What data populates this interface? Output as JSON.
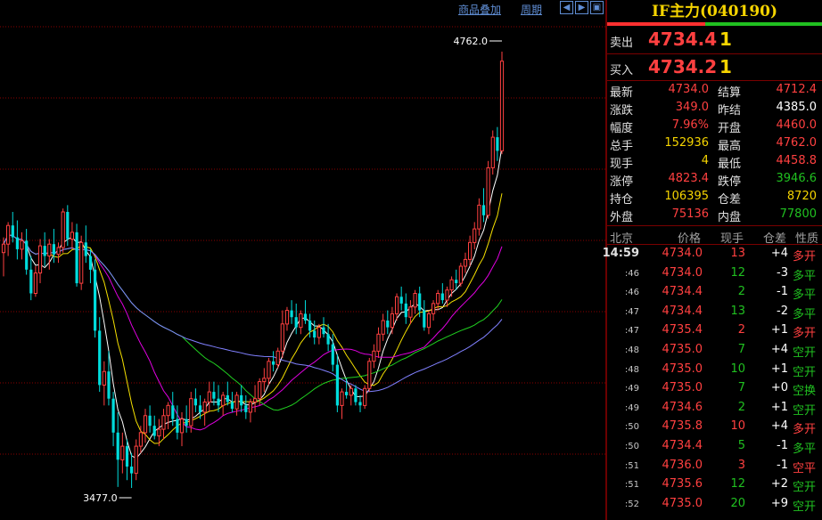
{
  "colors": {
    "up": "#ff4040",
    "down": "#00dcdc",
    "yellow": "#f5d400",
    "green": "#20c020",
    "grid": "#8a0000",
    "ma_white": "#ffffff",
    "ma_yellow": "#f5e000",
    "ma_magenta": "#e000e0",
    "ma_green": "#20d020",
    "ma_blue": "#8080ff"
  },
  "toolbar": {
    "overlay_label": "商品叠加",
    "period_label": "周期",
    "nav_icons": [
      "arrow-left-icon",
      "arrow-right-icon",
      "restore-icon"
    ]
  },
  "chart": {
    "high_label": "4762.0",
    "low_label": "3477.0",
    "candles": [
      {
        "o": 4170,
        "h": 4215,
        "l": 4100,
        "c": 4195
      },
      {
        "o": 4195,
        "h": 4260,
        "l": 4160,
        "c": 4250
      },
      {
        "o": 4250,
        "h": 4290,
        "l": 4200,
        "c": 4215
      },
      {
        "o": 4215,
        "h": 4265,
        "l": 4150,
        "c": 4180
      },
      {
        "o": 4180,
        "h": 4230,
        "l": 4150,
        "c": 4205
      },
      {
        "o": 4205,
        "h": 4240,
        "l": 4105,
        "c": 4120
      },
      {
        "o": 4120,
        "h": 4160,
        "l": 4030,
        "c": 4050
      },
      {
        "o": 4050,
        "h": 4130,
        "l": 4040,
        "c": 4110
      },
      {
        "o": 4110,
        "h": 4210,
        "l": 4080,
        "c": 4190
      },
      {
        "o": 4190,
        "h": 4230,
        "l": 4130,
        "c": 4160
      },
      {
        "o": 4160,
        "h": 4210,
        "l": 4120,
        "c": 4195
      },
      {
        "o": 4195,
        "h": 4240,
        "l": 4140,
        "c": 4165
      },
      {
        "o": 4165,
        "h": 4200,
        "l": 4140,
        "c": 4185
      },
      {
        "o": 4185,
        "h": 4300,
        "l": 4170,
        "c": 4290
      },
      {
        "o": 4290,
        "h": 4310,
        "l": 4190,
        "c": 4210
      },
      {
        "o": 4210,
        "h": 4260,
        "l": 4180,
        "c": 4230
      },
      {
        "o": 4230,
        "h": 4255,
        "l": 4070,
        "c": 4080
      },
      {
        "o": 4080,
        "h": 4220,
        "l": 4060,
        "c": 4200
      },
      {
        "o": 4200,
        "h": 4250,
        "l": 4140,
        "c": 4160
      },
      {
        "o": 4160,
        "h": 4180,
        "l": 4080,
        "c": 4120
      },
      {
        "o": 4120,
        "h": 4150,
        "l": 3920,
        "c": 3940
      },
      {
        "o": 3940,
        "h": 3980,
        "l": 3760,
        "c": 3780
      },
      {
        "o": 3780,
        "h": 3850,
        "l": 3720,
        "c": 3820
      },
      {
        "o": 3820,
        "h": 3880,
        "l": 3720,
        "c": 3740
      },
      {
        "o": 3740,
        "h": 3760,
        "l": 3600,
        "c": 3640
      },
      {
        "o": 3640,
        "h": 3700,
        "l": 3480,
        "c": 3560
      },
      {
        "o": 3560,
        "h": 3640,
        "l": 3520,
        "c": 3600
      },
      {
        "o": 3600,
        "h": 3620,
        "l": 3500,
        "c": 3540
      },
      {
        "o": 3540,
        "h": 3580,
        "l": 3477,
        "c": 3520
      },
      {
        "o": 3520,
        "h": 3620,
        "l": 3500,
        "c": 3600
      },
      {
        "o": 3600,
        "h": 3660,
        "l": 3580,
        "c": 3640
      },
      {
        "o": 3640,
        "h": 3710,
        "l": 3610,
        "c": 3690
      },
      {
        "o": 3690,
        "h": 3720,
        "l": 3640,
        "c": 3660
      },
      {
        "o": 3660,
        "h": 3690,
        "l": 3620,
        "c": 3630
      },
      {
        "o": 3630,
        "h": 3680,
        "l": 3600,
        "c": 3650
      },
      {
        "o": 3650,
        "h": 3710,
        "l": 3620,
        "c": 3690
      },
      {
        "o": 3690,
        "h": 3730,
        "l": 3650,
        "c": 3720
      },
      {
        "o": 3720,
        "h": 3760,
        "l": 3660,
        "c": 3680
      },
      {
        "o": 3680,
        "h": 3720,
        "l": 3620,
        "c": 3640
      },
      {
        "o": 3640,
        "h": 3700,
        "l": 3600,
        "c": 3680
      },
      {
        "o": 3680,
        "h": 3720,
        "l": 3640,
        "c": 3660
      },
      {
        "o": 3660,
        "h": 3760,
        "l": 3640,
        "c": 3740
      },
      {
        "o": 3740,
        "h": 3770,
        "l": 3700,
        "c": 3720
      },
      {
        "o": 3720,
        "h": 3750,
        "l": 3680,
        "c": 3700
      },
      {
        "o": 3700,
        "h": 3740,
        "l": 3660,
        "c": 3730
      },
      {
        "o": 3730,
        "h": 3790,
        "l": 3700,
        "c": 3760
      },
      {
        "o": 3760,
        "h": 3790,
        "l": 3720,
        "c": 3740
      },
      {
        "o": 3740,
        "h": 3780,
        "l": 3700,
        "c": 3720
      },
      {
        "o": 3720,
        "h": 3760,
        "l": 3690,
        "c": 3750
      },
      {
        "o": 3750,
        "h": 3790,
        "l": 3720,
        "c": 3730
      },
      {
        "o": 3730,
        "h": 3760,
        "l": 3700,
        "c": 3710
      },
      {
        "o": 3710,
        "h": 3760,
        "l": 3690,
        "c": 3750
      },
      {
        "o": 3750,
        "h": 3780,
        "l": 3700,
        "c": 3720
      },
      {
        "o": 3720,
        "h": 3750,
        "l": 3680,
        "c": 3700
      },
      {
        "o": 3700,
        "h": 3740,
        "l": 3670,
        "c": 3730
      },
      {
        "o": 3730,
        "h": 3780,
        "l": 3700,
        "c": 3740
      },
      {
        "o": 3740,
        "h": 3800,
        "l": 3720,
        "c": 3790
      },
      {
        "o": 3790,
        "h": 3830,
        "l": 3760,
        "c": 3800
      },
      {
        "o": 3800,
        "h": 3860,
        "l": 3780,
        "c": 3850
      },
      {
        "o": 3850,
        "h": 3880,
        "l": 3820,
        "c": 3840
      },
      {
        "o": 3840,
        "h": 3890,
        "l": 3830,
        "c": 3880
      },
      {
        "o": 3880,
        "h": 4000,
        "l": 3860,
        "c": 3960
      },
      {
        "o": 3960,
        "h": 4010,
        "l": 3940,
        "c": 4000
      },
      {
        "o": 4000,
        "h": 4030,
        "l": 3960,
        "c": 3980
      },
      {
        "o": 3980,
        "h": 4020,
        "l": 3930,
        "c": 3950
      },
      {
        "o": 3950,
        "h": 4000,
        "l": 3930,
        "c": 3990
      },
      {
        "o": 3990,
        "h": 4030,
        "l": 3960,
        "c": 3970
      },
      {
        "o": 3970,
        "h": 3990,
        "l": 3920,
        "c": 3940
      },
      {
        "o": 3940,
        "h": 3970,
        "l": 3900,
        "c": 3920
      },
      {
        "o": 3920,
        "h": 3960,
        "l": 3900,
        "c": 3950
      },
      {
        "o": 3950,
        "h": 3980,
        "l": 3920,
        "c": 3930
      },
      {
        "o": 3930,
        "h": 3960,
        "l": 3880,
        "c": 3900
      },
      {
        "o": 3900,
        "h": 3930,
        "l": 3820,
        "c": 3840
      },
      {
        "o": 3840,
        "h": 3870,
        "l": 3700,
        "c": 3720
      },
      {
        "o": 3720,
        "h": 3770,
        "l": 3680,
        "c": 3760
      },
      {
        "o": 3760,
        "h": 3800,
        "l": 3740,
        "c": 3750
      },
      {
        "o": 3750,
        "h": 3780,
        "l": 3720,
        "c": 3770
      },
      {
        "o": 3770,
        "h": 3780,
        "l": 3720,
        "c": 3730
      },
      {
        "o": 3730,
        "h": 3750,
        "l": 3700,
        "c": 3720
      },
      {
        "o": 3720,
        "h": 3780,
        "l": 3710,
        "c": 3770
      },
      {
        "o": 3770,
        "h": 3860,
        "l": 3760,
        "c": 3850
      },
      {
        "o": 3850,
        "h": 3900,
        "l": 3830,
        "c": 3880
      },
      {
        "o": 3880,
        "h": 3950,
        "l": 3860,
        "c": 3930
      },
      {
        "o": 3930,
        "h": 3990,
        "l": 3910,
        "c": 3970
      },
      {
        "o": 3970,
        "h": 4000,
        "l": 3930,
        "c": 3950
      },
      {
        "o": 3950,
        "h": 4010,
        "l": 3930,
        "c": 3990
      },
      {
        "o": 3990,
        "h": 4050,
        "l": 3970,
        "c": 4040
      },
      {
        "o": 4040,
        "h": 4070,
        "l": 4000,
        "c": 4020
      },
      {
        "o": 4020,
        "h": 4050,
        "l": 3960,
        "c": 3980
      },
      {
        "o": 3980,
        "h": 4030,
        "l": 3960,
        "c": 4010
      },
      {
        "o": 4010,
        "h": 4060,
        "l": 3990,
        "c": 4050
      },
      {
        "o": 4050,
        "h": 4070,
        "l": 3980,
        "c": 4000
      },
      {
        "o": 4000,
        "h": 4030,
        "l": 3940,
        "c": 3950
      },
      {
        "o": 3950,
        "h": 4000,
        "l": 3930,
        "c": 3990
      },
      {
        "o": 3990,
        "h": 4030,
        "l": 3970,
        "c": 4020
      },
      {
        "o": 4020,
        "h": 4060,
        "l": 4000,
        "c": 4050
      },
      {
        "o": 4050,
        "h": 4080,
        "l": 4020,
        "c": 4030
      },
      {
        "o": 4030,
        "h": 4070,
        "l": 4010,
        "c": 4060
      },
      {
        "o": 4060,
        "h": 4100,
        "l": 4040,
        "c": 4090
      },
      {
        "o": 4090,
        "h": 4120,
        "l": 4060,
        "c": 4080
      },
      {
        "o": 4080,
        "h": 4140,
        "l": 4070,
        "c": 4130
      },
      {
        "o": 4130,
        "h": 4170,
        "l": 4110,
        "c": 4150
      },
      {
        "o": 4150,
        "h": 4220,
        "l": 4130,
        "c": 4200
      },
      {
        "o": 4200,
        "h": 4260,
        "l": 4180,
        "c": 4240
      },
      {
        "o": 4240,
        "h": 4330,
        "l": 4220,
        "c": 4310
      },
      {
        "o": 4310,
        "h": 4360,
        "l": 4260,
        "c": 4280
      },
      {
        "o": 4280,
        "h": 4440,
        "l": 4270,
        "c": 4420
      },
      {
        "o": 4420,
        "h": 4530,
        "l": 4400,
        "c": 4510
      },
      {
        "o": 4510,
        "h": 4540,
        "l": 4440,
        "c": 4470
      },
      {
        "o": 4470,
        "h": 4762,
        "l": 4460,
        "c": 4734
      }
    ]
  },
  "panel": {
    "title": "IF主力(040190)",
    "sell_label": "卖出",
    "sell_price": "4734.4",
    "sell_vol": "1",
    "buy_label": "买入",
    "buy_price": "4734.2",
    "buy_vol": "1",
    "stats": [
      {
        "l1": "最新",
        "v1": "4734.0",
        "c1": "#ff4040",
        "l2": "结算",
        "v2": "4712.4",
        "c2": "#ff4040"
      },
      {
        "l1": "涨跌",
        "v1": "349.0",
        "c1": "#ff4040",
        "l2": "昨结",
        "v2": "4385.0",
        "c2": "#ffffff"
      },
      {
        "l1": "幅度",
        "v1": "7.96%",
        "c1": "#ff4040",
        "l2": "开盘",
        "v2": "4460.0",
        "c2": "#ff4040"
      },
      {
        "l1": "总手",
        "v1": "152936",
        "c1": "#f5d400",
        "l2": "最高",
        "v2": "4762.0",
        "c2": "#ff4040"
      },
      {
        "l1": "现手",
        "v1": "4",
        "c1": "#f5d400",
        "l2": "最低",
        "v2": "4458.8",
        "c2": "#ff4040"
      },
      {
        "l1": "涨停",
        "v1": "4823.4",
        "c1": "#ff4040",
        "l2": "跌停",
        "v2": "3946.6",
        "c2": "#20c020"
      },
      {
        "l1": "持仓",
        "v1": "106395",
        "c1": "#f5d400",
        "l2": "仓差",
        "v2": "8720",
        "c2": "#f5d400"
      },
      {
        "l1": "外盘",
        "v1": "75136",
        "c1": "#ff4040",
        "l2": "内盘",
        "v2": "77800",
        "c2": "#20c020"
      }
    ],
    "tick_headers": {
      "loc": "北京",
      "price": "价格",
      "vol": "现手",
      "chg": "仓差",
      "nat": "性质"
    },
    "ticks": [
      {
        "time": "14:59",
        "price": "4734.0",
        "vol": "13",
        "vc": "#ff4040",
        "chg": "+4",
        "nat": "多开",
        "nc": "#ff4040"
      },
      {
        "time": ":46",
        "price": "4734.0",
        "vol": "12",
        "vc": "#20c020",
        "chg": "-3",
        "nat": "多平",
        "nc": "#20c020"
      },
      {
        "time": ":46",
        "price": "4734.4",
        "vol": "2",
        "vc": "#20c020",
        "chg": "-1",
        "nat": "多平",
        "nc": "#20c020"
      },
      {
        "time": ":47",
        "price": "4734.4",
        "vol": "13",
        "vc": "#20c020",
        "chg": "-2",
        "nat": "多平",
        "nc": "#20c020"
      },
      {
        "time": ":47",
        "price": "4735.4",
        "vol": "2",
        "vc": "#ff4040",
        "chg": "+1",
        "nat": "多开",
        "nc": "#ff4040"
      },
      {
        "time": ":48",
        "price": "4735.0",
        "vol": "7",
        "vc": "#20c020",
        "chg": "+4",
        "nat": "空开",
        "nc": "#20c020"
      },
      {
        "time": ":48",
        "price": "4735.0",
        "vol": "10",
        "vc": "#20c020",
        "chg": "+1",
        "nat": "空开",
        "nc": "#20c020"
      },
      {
        "time": ":49",
        "price": "4735.0",
        "vol": "7",
        "vc": "#20c020",
        "chg": "+0",
        "nat": "空换",
        "nc": "#20c020"
      },
      {
        "time": ":49",
        "price": "4734.6",
        "vol": "2",
        "vc": "#20c020",
        "chg": "+1",
        "nat": "空开",
        "nc": "#20c020"
      },
      {
        "time": ":50",
        "price": "4735.8",
        "vol": "10",
        "vc": "#ff4040",
        "chg": "+4",
        "nat": "多开",
        "nc": "#ff4040"
      },
      {
        "time": ":50",
        "price": "4734.4",
        "vol": "5",
        "vc": "#20c020",
        "chg": "-1",
        "nat": "多平",
        "nc": "#20c020"
      },
      {
        "time": ":51",
        "price": "4736.0",
        "vol": "3",
        "vc": "#ff4040",
        "chg": "-1",
        "nat": "空平",
        "nc": "#ff4040"
      },
      {
        "time": ":51",
        "price": "4735.6",
        "vol": "12",
        "vc": "#20c020",
        "chg": "+2",
        "nat": "空开",
        "nc": "#20c020"
      },
      {
        "time": ":52",
        "price": "4735.0",
        "vol": "20",
        "vc": "#20c020",
        "chg": "+9",
        "nat": "空开",
        "nc": "#20c020"
      }
    ]
  }
}
